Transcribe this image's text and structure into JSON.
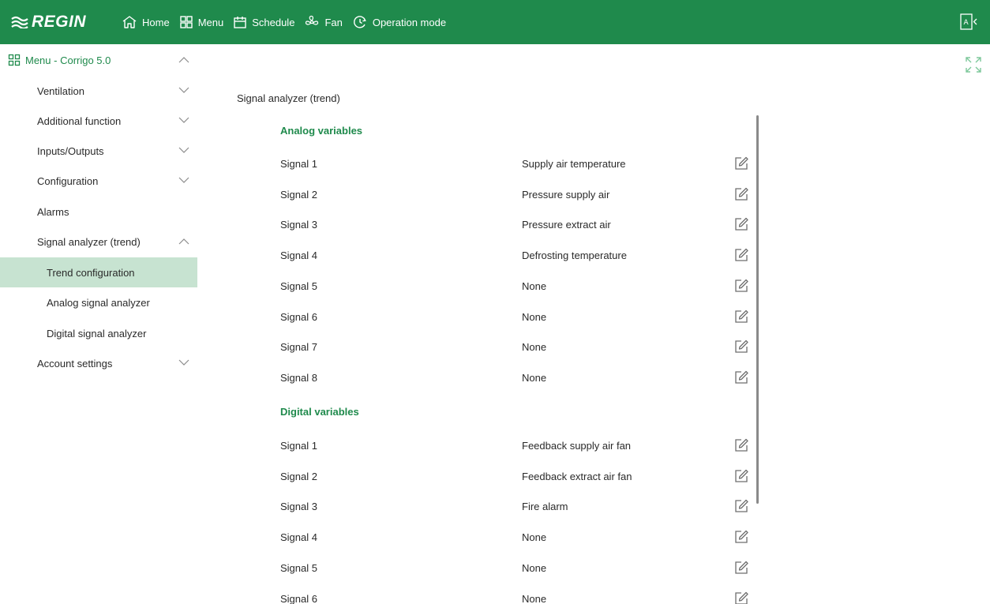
{
  "brand": {
    "name": "REGIN",
    "color": "#1f8a4c",
    "icon": "regin-logo-icon"
  },
  "nav": [
    {
      "label": "Home",
      "icon": "home-icon"
    },
    {
      "label": "Menu",
      "icon": "grid-icon"
    },
    {
      "label": "Schedule",
      "icon": "calendar-icon"
    },
    {
      "label": "Fan",
      "icon": "fan-icon"
    },
    {
      "label": "Operation mode",
      "icon": "clock-icon"
    }
  ],
  "sidebar": {
    "root": {
      "label": "Menu - Corrigo 5.0",
      "icon": "grid-icon",
      "expanded": true
    },
    "items": [
      {
        "label": "Ventilation",
        "expanded": false
      },
      {
        "label": "Additional function",
        "expanded": false
      },
      {
        "label": "Inputs/Outputs",
        "expanded": false
      },
      {
        "label": "Configuration",
        "expanded": false
      },
      {
        "label": "Alarms"
      },
      {
        "label": "Signal analyzer (trend)",
        "expanded": true
      },
      {
        "label": "Trend configuration",
        "active": true
      },
      {
        "label": "Analog signal analyzer"
      },
      {
        "label": "Digital signal analyzer"
      },
      {
        "label": "Account settings",
        "expanded": false
      }
    ]
  },
  "main": {
    "title": "Signal analyzer (trend)",
    "analog": {
      "heading": "Analog variables",
      "rows": [
        {
          "signal": "Signal 1",
          "value": "Supply air temperature"
        },
        {
          "signal": "Signal 2",
          "value": "Pressure supply air"
        },
        {
          "signal": "Signal 3",
          "value": "Pressure extract air"
        },
        {
          "signal": "Signal 4",
          "value": "Defrosting temperature"
        },
        {
          "signal": "Signal 5",
          "value": "None"
        },
        {
          "signal": "Signal 6",
          "value": "None"
        },
        {
          "signal": "Signal 7",
          "value": "None"
        },
        {
          "signal": "Signal 8",
          "value": "None"
        }
      ]
    },
    "digital": {
      "heading": "Digital variables",
      "rows": [
        {
          "signal": "Signal 1",
          "value": "Feedback supply air fan"
        },
        {
          "signal": "Signal 2",
          "value": "Feedback extract air fan"
        },
        {
          "signal": "Signal 3",
          "value": "Fire alarm"
        },
        {
          "signal": "Signal 4",
          "value": "None"
        },
        {
          "signal": "Signal 5",
          "value": "None"
        },
        {
          "signal": "Signal 6",
          "value": "None"
        }
      ]
    }
  },
  "colors": {
    "accent": "#1f8a4c",
    "active_bg": "#c7e3d1",
    "text": "#2a2a2a"
  }
}
